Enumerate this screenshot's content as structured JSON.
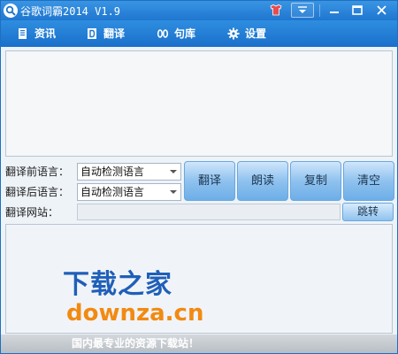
{
  "window": {
    "title": "谷歌词霸2014 V1.9"
  },
  "titlebar": {
    "icons": [
      "search-icon",
      "skin-icon",
      "menu-dropdown-icon",
      "minimize-icon",
      "maximize-icon",
      "close-icon"
    ]
  },
  "menu": {
    "items": [
      {
        "label": "资讯",
        "icon": "news-icon"
      },
      {
        "label": "翻译",
        "icon": "translate-icon"
      },
      {
        "label": "句库",
        "icon": "phrase-icon"
      },
      {
        "label": "设置",
        "icon": "gear-icon"
      }
    ]
  },
  "controls": {
    "source_label": "翻译前语言：",
    "source_value": "自动检测语言",
    "target_label": "翻译后语言：",
    "target_value": "自动检测语言",
    "site_label": "翻译网站：",
    "site_value": ""
  },
  "buttons": {
    "translate": "翻译",
    "read": "朗读",
    "copy": "复制",
    "clear": "清空",
    "jump": "跳转"
  },
  "watermark": {
    "title": "下载之家",
    "domain": "downza.cn"
  },
  "footer": {
    "text": "国内最专业的资源下载站！"
  },
  "colors": {
    "titlebar": "#1f76cf",
    "button": "#8fc2ee",
    "watermark_title": "#1f5fb8",
    "watermark_domain": "#f28a12"
  }
}
